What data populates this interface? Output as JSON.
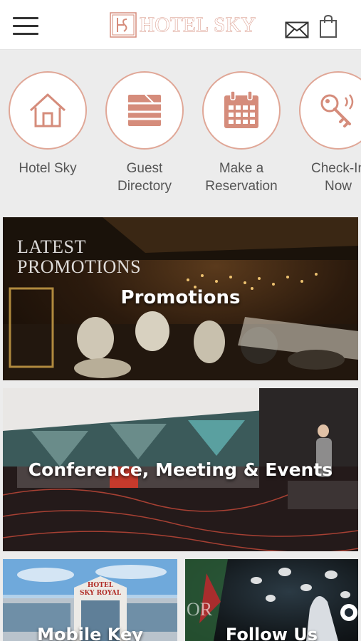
{
  "header": {
    "brand": "HOTEL SKY",
    "logo_mark": "HS",
    "menu_icon": "hamburger-menu-icon",
    "mail_icon": "mail-icon",
    "bag_icon": "shopping-bag-icon"
  },
  "colors": {
    "accent": "#d58c7b",
    "accent_light": "#e0a797",
    "header_bg": "#ffffff",
    "page_bg": "#ececec",
    "label_text": "#555555"
  },
  "quick_links": [
    {
      "label": "Hotel Sky",
      "icon": "house-icon"
    },
    {
      "label": "Guest\nDirectory",
      "icon": "book-icon"
    },
    {
      "label": "Make a\nReservation",
      "icon": "calendar-icon"
    },
    {
      "label": "Check-In\nNow",
      "icon": "key-icon"
    }
  ],
  "banners": {
    "promotions": {
      "title": "Promotions",
      "overlay": "LATEST\nPROMOTIONS"
    },
    "conference": {
      "title": "Conference, Meeting & Events"
    },
    "mobile_key": {
      "title": "Mobile Key",
      "sign": "HOTEL\nSKY ROYAL"
    },
    "follow_us": {
      "title": "Follow Us",
      "overlay": "OR"
    }
  }
}
